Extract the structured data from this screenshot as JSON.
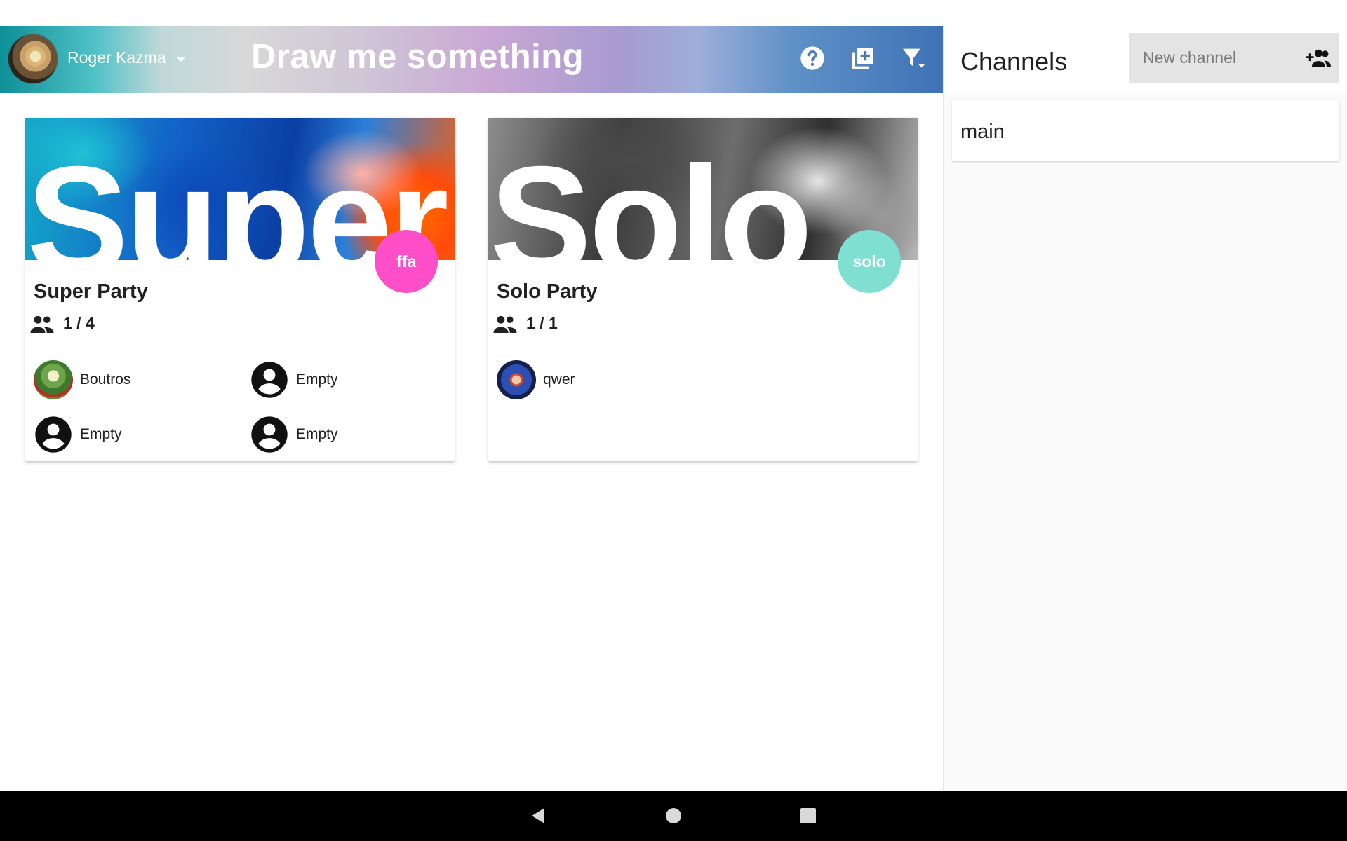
{
  "user": {
    "name": "Roger Kazma"
  },
  "app": {
    "title": "Draw me something"
  },
  "header_icons": [
    "help-icon",
    "add-box-icon",
    "filter-icon"
  ],
  "parties": [
    {
      "hero_word": "Super",
      "title": "Super Party",
      "type": "ffa",
      "type_color": "#ff4fc8",
      "players": "1 / 4",
      "slots": [
        {
          "name": "Boutros",
          "filled": true
        },
        {
          "name": "Empty",
          "filled": false
        },
        {
          "name": "Empty",
          "filled": false
        },
        {
          "name": "Empty",
          "filled": false
        }
      ]
    },
    {
      "hero_word": "Solo",
      "title": "Solo Party",
      "type": "solo",
      "type_color": "#7fe0d2",
      "players": "1 / 1",
      "slots": [
        {
          "name": "qwer",
          "filled": true
        }
      ]
    }
  ],
  "channels": {
    "title": "Channels",
    "new_channel_placeholder": "New channel",
    "items": [
      "main"
    ]
  },
  "nav": [
    "back",
    "home",
    "recents"
  ]
}
